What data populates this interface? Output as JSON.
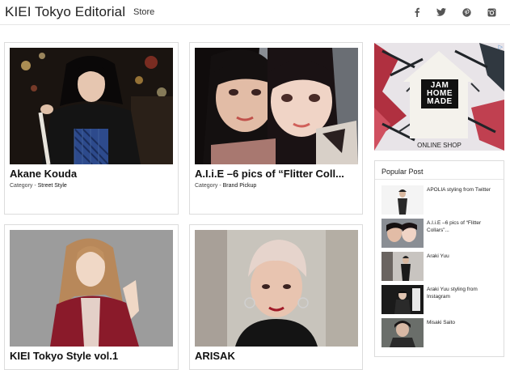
{
  "header": {
    "site_title": "KIEI Tokyo Editorial",
    "nav_store": "Store",
    "social_icons": [
      {
        "name": "facebook-icon",
        "glyph": "f"
      },
      {
        "name": "twitter-icon",
        "glyph": "t"
      },
      {
        "name": "pinterest-icon",
        "glyph": "p"
      },
      {
        "name": "instagram-icon",
        "glyph": "i"
      }
    ]
  },
  "posts": [
    {
      "title": "Akane Kouda",
      "category_prefix": "Category - ",
      "category": "Street Style"
    },
    {
      "title": "A.I.i.E –6 pics of “Flitter Coll...",
      "category_prefix": "Category - ",
      "category": "Brand Pickup"
    },
    {
      "title": "KIEI Tokyo Style vol.1"
    },
    {
      "title": "ARISAK"
    }
  ],
  "ad": {
    "brand_line1": "JAM",
    "brand_line2": "HOME",
    "brand_line3": "MADE",
    "label": "ONLINE SHOP"
  },
  "sidebar": {
    "title": "Popular Post",
    "items": [
      {
        "label": "APOLIA styling from Twitter"
      },
      {
        "label": "A.I.i.E –6 pics of “Flitter Collars”..."
      },
      {
        "label": "Araki Yuu"
      },
      {
        "label": "Araki Yuu styling from Instagram"
      },
      {
        "label": "Misaki Saito"
      }
    ]
  },
  "colors": {
    "border": "#dcdcdc",
    "text": "#222222",
    "ad_link": "#4a90d9"
  }
}
